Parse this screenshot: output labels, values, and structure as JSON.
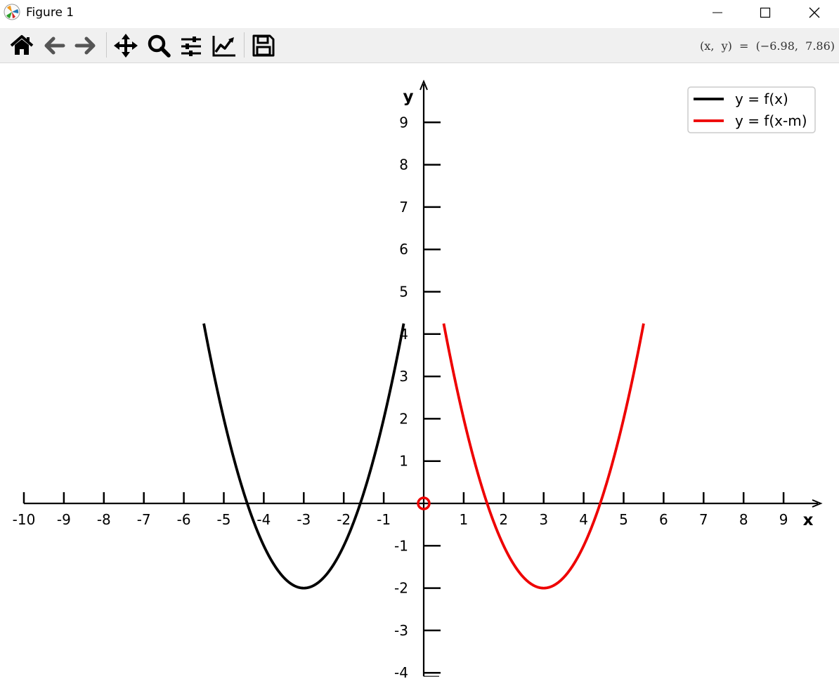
{
  "window": {
    "title": "Figure 1",
    "app_icon": "matplotlib-icon",
    "controls": [
      "minimize-icon",
      "maximize-icon",
      "close-icon"
    ]
  },
  "toolbar": {
    "buttons": [
      "home-icon",
      "back-arrow-icon",
      "forward-arrow-icon",
      "pan-move-icon",
      "zoom-magnifier-icon",
      "configure-subplots-icon",
      "edit-axes-icon",
      "save-floppy-icon"
    ],
    "coords_label": "(x,  y)  =  (−6.98,  7.86)"
  },
  "chart_data": {
    "type": "line",
    "title": "",
    "xlabel": "x",
    "ylabel": "y",
    "xlim": [
      -10,
      10
    ],
    "ylim": [
      -4,
      10
    ],
    "xticks": [
      -10,
      -9,
      -8,
      -7,
      -6,
      -5,
      -4,
      -3,
      -2,
      -1,
      1,
      2,
      3,
      4,
      5,
      6,
      7,
      8,
      9
    ],
    "yticks": [
      -4,
      -3,
      -2,
      -1,
      1,
      2,
      3,
      4,
      5,
      6,
      7,
      8,
      9
    ],
    "grid": false,
    "legend_position": "top-right",
    "series": [
      {
        "name": "y = f(x)",
        "color": "#000000",
        "function": "(x+3)^2 - 2",
        "x_range": [
          -5.5,
          -0.5
        ]
      },
      {
        "name": "y = f(x-m)",
        "color": "#ee0000",
        "function": "(x-3)^2 - 2",
        "x_range": [
          0.5,
          5.5
        ]
      }
    ],
    "marker": {
      "x": 0,
      "y": 0,
      "style": "open-circle",
      "color": "#ee0000"
    }
  }
}
